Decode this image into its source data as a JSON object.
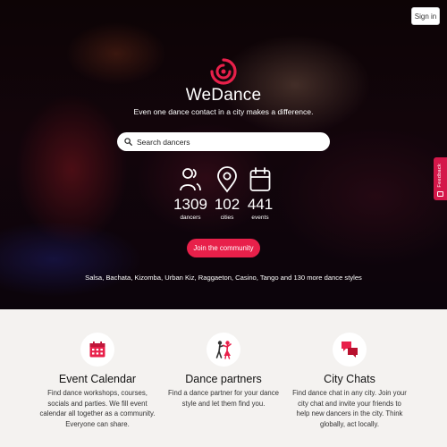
{
  "header": {
    "signin_label": "Sign in"
  },
  "hero": {
    "brand": "WeDance",
    "tagline": "Even one dance contact in a city makes a difference.",
    "search": {
      "placeholder": "Search dancers",
      "value": ""
    },
    "stats": [
      {
        "value": "1309",
        "label": "dancers",
        "icon": "users-icon"
      },
      {
        "value": "102",
        "label": "cities",
        "icon": "map-pin-icon"
      },
      {
        "value": "441",
        "label": "events",
        "icon": "calendar-icon"
      }
    ],
    "cta_label": "Join the community",
    "styles_text": "Salsa, Bachata, Kizomba, Urban Kiz, Raggaeton, Casino, Tango and 130 more dance styles"
  },
  "feedback_tab": {
    "label": "Feedback"
  },
  "features": [
    {
      "title": "Event Calendar",
      "icon": "calendar-event-icon",
      "lines": [
        "Find dance workshops, courses,",
        "socials and parties. We fill event",
        "calendar all together as a community.",
        "Everyone can share."
      ]
    },
    {
      "title": "Dance partners",
      "icon": "dancing-couple-icon",
      "lines": [
        "Find a dance partner for your dance",
        "style and let them find you."
      ]
    },
    {
      "title": "City Chats",
      "icon": "chat-bubbles-icon",
      "lines": [
        "Find dance chat in any city. Join your",
        "city chat and invite your friends to",
        "help new dancers in the city. Think",
        "globally, act locally."
      ]
    }
  ],
  "colors": {
    "accent": "#e8204a",
    "feedback": "#d4184a",
    "section_bg": "#f4f2f0"
  }
}
